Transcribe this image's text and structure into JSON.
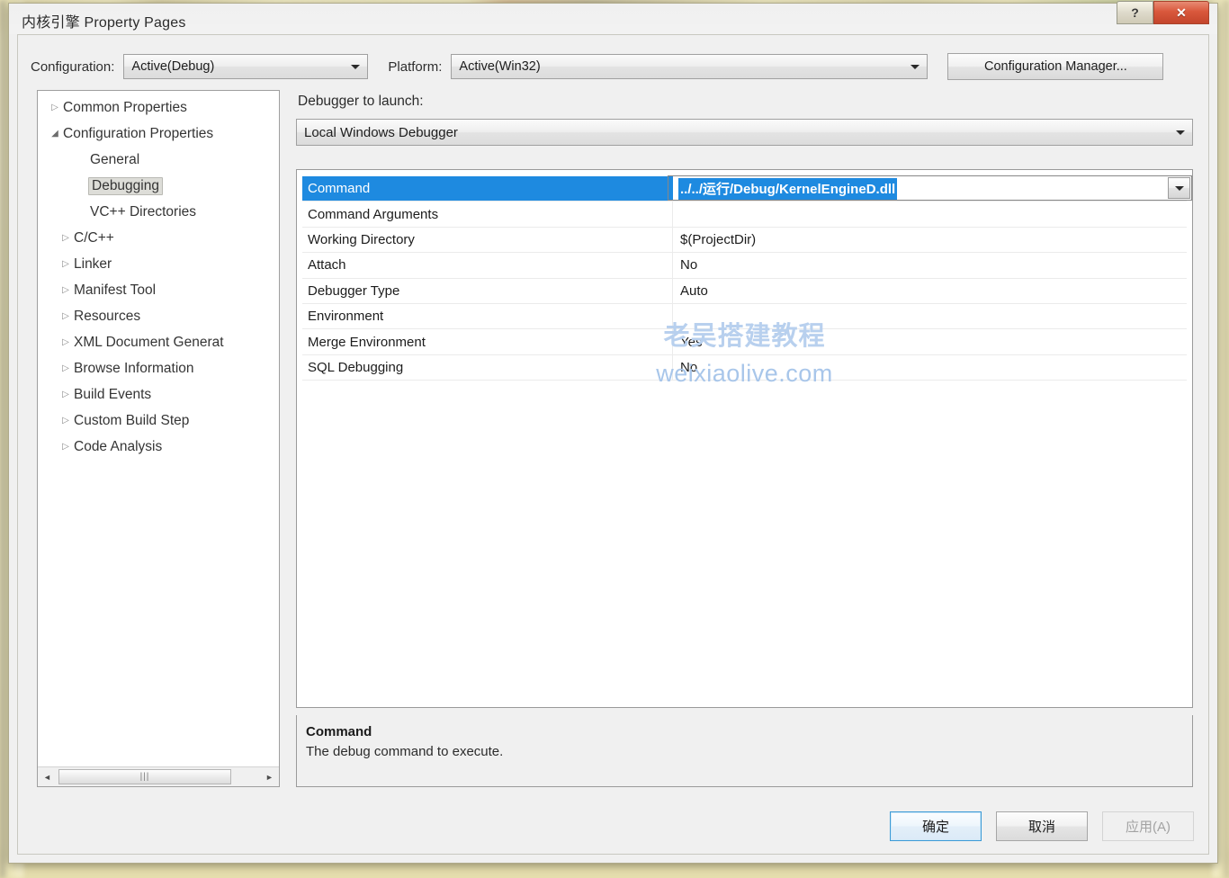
{
  "window": {
    "title": "内核引擎 Property Pages",
    "help_button": "?",
    "close_button": "✕"
  },
  "config_bar": {
    "configuration_label": "Configuration:",
    "configuration_value": "Active(Debug)",
    "platform_label": "Platform:",
    "platform_value": "Active(Win32)",
    "configuration_manager_label": "Configuration Manager..."
  },
  "tree": {
    "items": [
      {
        "label": "Common Properties",
        "level": 0,
        "twisty": "collapsed",
        "selected": false
      },
      {
        "label": "Configuration Properties",
        "level": 0,
        "twisty": "expanded",
        "selected": false
      },
      {
        "label": "General",
        "level": 1,
        "twisty": "none",
        "selected": false
      },
      {
        "label": "Debugging",
        "level": 1,
        "twisty": "none",
        "selected": true
      },
      {
        "label": "VC++ Directories",
        "level": 1,
        "twisty": "none",
        "selected": false
      },
      {
        "label": "C/C++",
        "level": 1,
        "twisty": "collapsed",
        "selected": false
      },
      {
        "label": "Linker",
        "level": 1,
        "twisty": "collapsed",
        "selected": false
      },
      {
        "label": "Manifest Tool",
        "level": 1,
        "twisty": "collapsed",
        "selected": false
      },
      {
        "label": "Resources",
        "level": 1,
        "twisty": "collapsed",
        "selected": false
      },
      {
        "label": "XML Document Generat",
        "level": 1,
        "twisty": "collapsed",
        "selected": false
      },
      {
        "label": "Browse Information",
        "level": 1,
        "twisty": "collapsed",
        "selected": false
      },
      {
        "label": "Build Events",
        "level": 1,
        "twisty": "collapsed",
        "selected": false
      },
      {
        "label": "Custom Build Step",
        "level": 1,
        "twisty": "collapsed",
        "selected": false
      },
      {
        "label": "Code Analysis",
        "level": 1,
        "twisty": "collapsed",
        "selected": false
      }
    ],
    "scroll_left_arrow": "◄",
    "scroll_right_arrow": "►",
    "scroll_thumb_grip": "|||"
  },
  "main": {
    "debugger_label": "Debugger to launch:",
    "debugger_value": "Local Windows Debugger",
    "properties": [
      {
        "name": "Command",
        "value": "../../运行/Debug/KernelEngineD.dll",
        "selected": true
      },
      {
        "name": "Command Arguments",
        "value": "",
        "selected": false
      },
      {
        "name": "Working Directory",
        "value": "$(ProjectDir)",
        "selected": false
      },
      {
        "name": "Attach",
        "value": "No",
        "selected": false
      },
      {
        "name": "Debugger Type",
        "value": "Auto",
        "selected": false
      },
      {
        "name": "Environment",
        "value": "",
        "selected": false
      },
      {
        "name": "Merge Environment",
        "value": "Yes",
        "selected": false
      },
      {
        "name": "SQL Debugging",
        "value": "No",
        "selected": false
      }
    ]
  },
  "watermark": {
    "line1": "老吴搭建教程",
    "line2": "weixiaolive.com"
  },
  "description": {
    "title": "Command",
    "text": "The debug command to execute."
  },
  "buttons": {
    "ok": "确定",
    "cancel": "取消",
    "apply": "应用(A)"
  },
  "colors": {
    "selection_blue": "#1e8ae0",
    "close_red": "#d9583c",
    "watermark_blue": "#b8d0ee"
  }
}
